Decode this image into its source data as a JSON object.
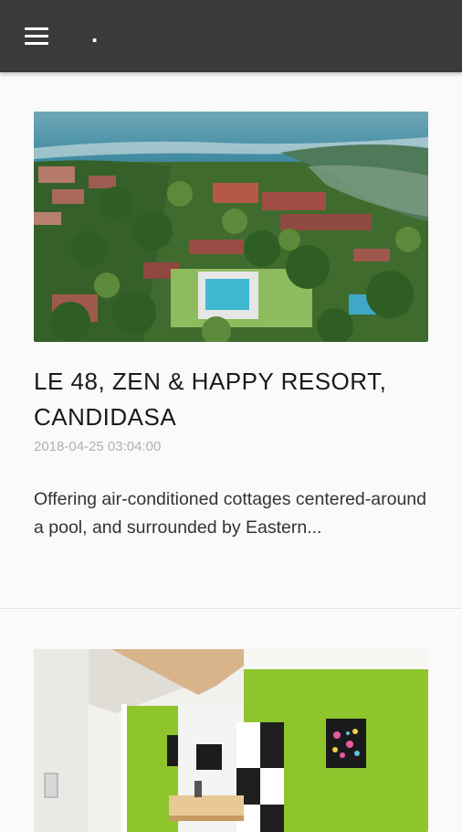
{
  "app_bar": {
    "title": ".",
    "menu_icon": "hamburger-menu-icon",
    "background": "#3a3a3a"
  },
  "posts": [
    {
      "title": "LE 48, ZEN & HAPPY RESORT, CANDIDASA",
      "date": "2018-04-25 03:04:00",
      "excerpt": "Offering air-conditioned cottages centered-around a pool, and surrounded by Eastern..."
    },
    {
      "title": "",
      "date": "",
      "excerpt": ""
    }
  ]
}
